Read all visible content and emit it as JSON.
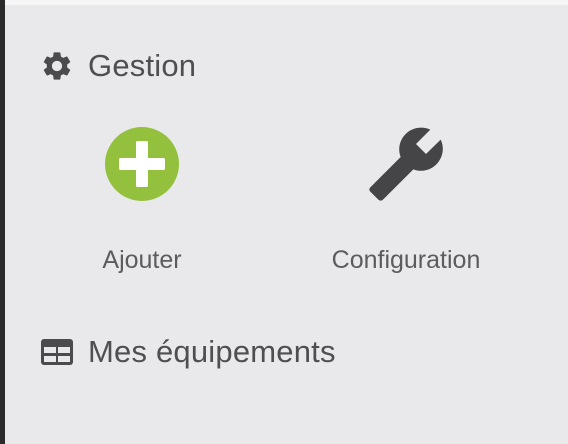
{
  "colors": {
    "background": "#e9e9eb",
    "text": "#4f4f52",
    "accent_green": "#94c13d",
    "icon_dark": "#454548"
  },
  "gestion": {
    "title": "Gestion",
    "icon": "gear-icon",
    "actions": [
      {
        "label": "Ajouter",
        "icon": "plus-circle-icon"
      },
      {
        "label": "Configuration",
        "icon": "wrench-icon"
      }
    ]
  },
  "equipements": {
    "title": "Mes équipements",
    "icon": "table-icon"
  }
}
